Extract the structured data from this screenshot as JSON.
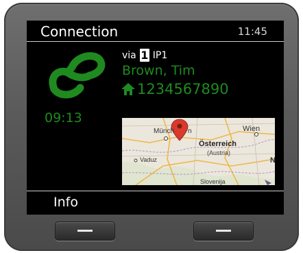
{
  "header": {
    "title": "Connection",
    "time": "11:45"
  },
  "call": {
    "via_label": "via",
    "line_number": "1",
    "line_name": "IP1",
    "caller_name": "Brown, Tim",
    "phone_number": "1234567890",
    "duration": "09:13"
  },
  "map": {
    "labels": {
      "munchen": "Münch",
      "munchen_tail": "n",
      "wien": "Wien",
      "osterreich": "Österreich",
      "austria": "(Austria)",
      "vaduz": "Vaduz",
      "slovenija": "Slovenija",
      "edge_n": "N"
    }
  },
  "softkeys": {
    "left": "Info"
  },
  "colors": {
    "accent_green": "#1f8a1f",
    "screen_bg": "#000000",
    "bezel": "#5a5a5a"
  },
  "icons": {
    "call": "handset-icon",
    "number_type": "home-icon",
    "map_pin": "map-pin-icon"
  }
}
